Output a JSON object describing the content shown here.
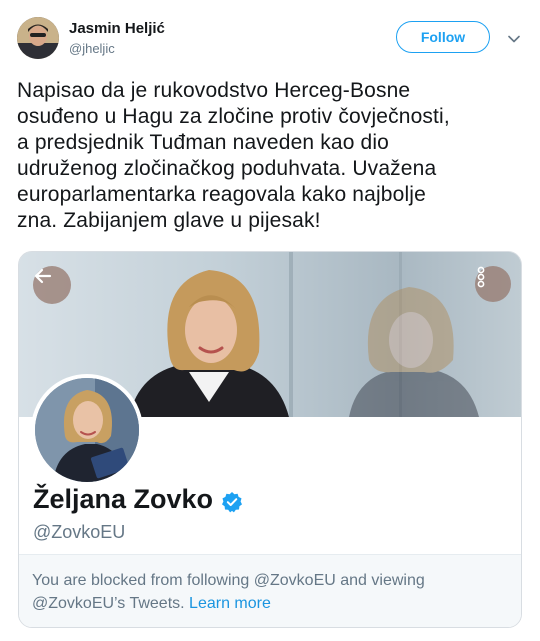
{
  "tweet": {
    "author_name": "Jasmin Heljić",
    "author_handle": "@jheljic",
    "follow_label": "Follow",
    "text": "Napisao da je rukovodstvo Herceg-Bosne\nosuđeno u Hagu za zločine protiv čovječnosti,\na predsjednik Tuđman naveden kao dio\nudruženog zločinačkog poduhvata. Uvažena\neuroparlamentarka reagovala kako najbolje\nzna. Zabijanjem glave u pijesak!"
  },
  "embedded_profile": {
    "name": "Željana Zovko",
    "handle": "@ZovkoEU",
    "verified": true,
    "blocked_message_prefix": "You are blocked from following @ZovkoEU and viewing @ZovkoEU’s Tweets.",
    "learn_more_label": "Learn more"
  },
  "icons": {
    "caret": "chevron-down-icon",
    "back": "back-arrow-icon",
    "more": "more-vertical-icon",
    "verified": "verified-badge-icon"
  },
  "colors": {
    "accent": "#1da1f2",
    "link": "#1b95e0",
    "muted_text": "#657786",
    "primary_text": "#14171a",
    "overlay_button": "#96786e"
  }
}
